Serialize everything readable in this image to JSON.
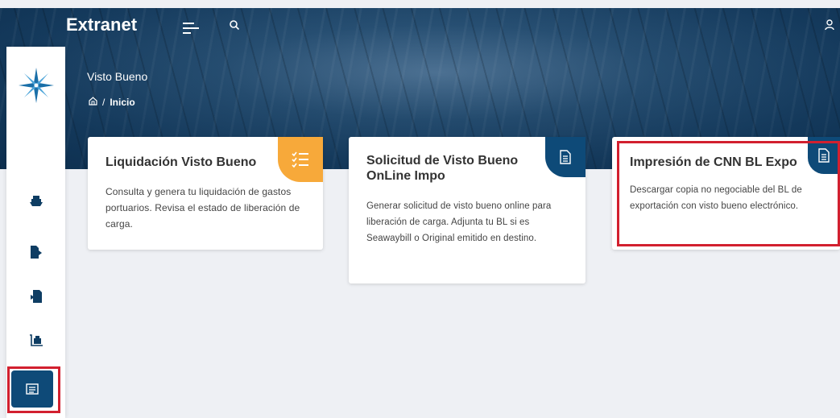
{
  "app": {
    "brand": "Extranet"
  },
  "icons": {
    "menu": "menu-icon",
    "search": "search-icon",
    "user": "user-icon",
    "home": "home-icon"
  },
  "colors": {
    "primary": "#0e4a78",
    "accent": "#f7a93a",
    "highlight": "#d2202f",
    "background": "#eef0f4"
  },
  "header": {
    "page_title": "Visto Bueno",
    "breadcrumb": {
      "separator": "/",
      "current": "Inicio"
    }
  },
  "sidebar": {
    "items": [
      {
        "icon": "ship-icon"
      },
      {
        "icon": "export-document-icon"
      },
      {
        "icon": "import-document-icon"
      },
      {
        "icon": "cargo-trolley-icon"
      },
      {
        "icon": "list-document-icon",
        "active": true
      }
    ]
  },
  "cards": [
    {
      "title": "Liquidación Visto Bueno",
      "description": "Consulta y genera tu liquidación de gastos portuarios. Revisa el estado de liberación de carga.",
      "icon": "checklist-icon"
    },
    {
      "title": "Solicitud de Visto Bueno OnLine Impo",
      "description": "Generar solicitud de visto bueno online para liberación de carga. Adjunta tu BL si es Seawaybill o Original emitido en destino.",
      "icon": "document-icon"
    },
    {
      "title": "Impresión de CNN BL Expo",
      "description": "Descargar copia no negociable del BL de exportación con visto bueno electrónico.",
      "icon": "document-icon"
    }
  ]
}
